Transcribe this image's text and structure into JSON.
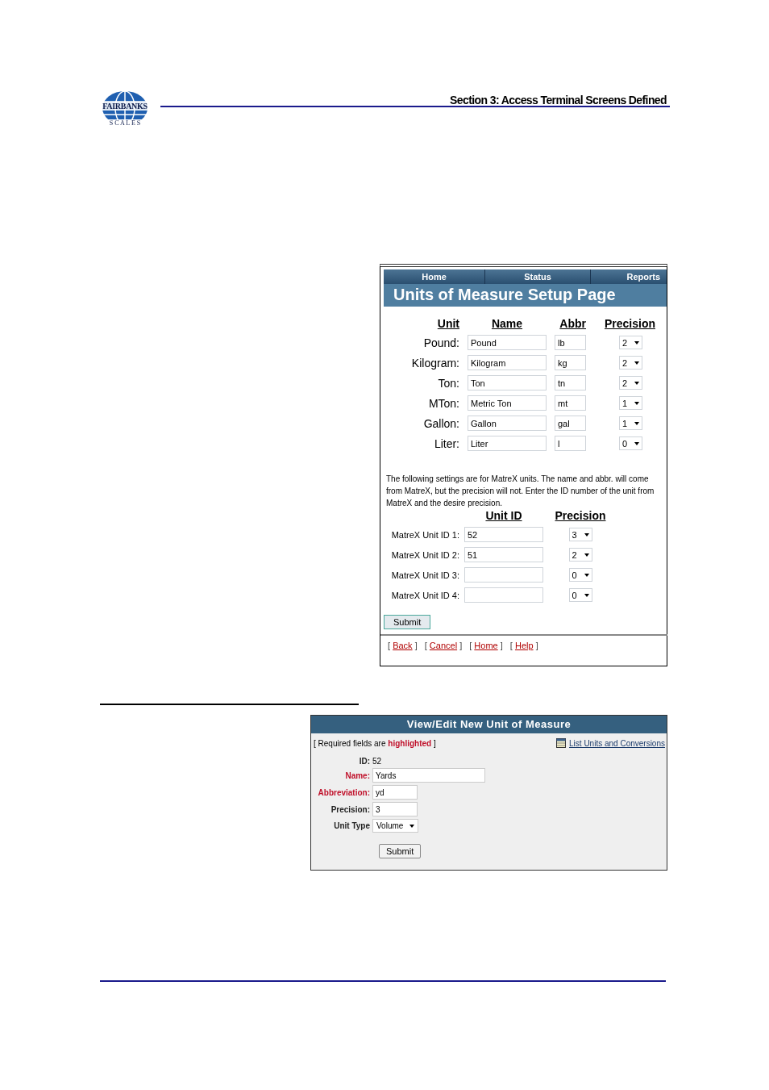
{
  "header": {
    "logo_text": "FAIRBANKS",
    "logo_subtext": "S C A L E S",
    "section_title": "Section 3:  Access Terminal Screens Defined"
  },
  "setup_page": {
    "nav": [
      {
        "label": "Home"
      },
      {
        "label": "Status"
      },
      {
        "label": "Reports"
      }
    ],
    "title": "Units of Measure Setup Page",
    "columns": [
      "Unit",
      "Name",
      "Abbr",
      "Precision"
    ],
    "units": [
      {
        "unit": "Pound:",
        "name": "Pound",
        "abbr": "lb",
        "precision": "2"
      },
      {
        "unit": "Kilogram:",
        "name": "Kilogram",
        "abbr": "kg",
        "precision": "2"
      },
      {
        "unit": "Ton:",
        "name": "Ton",
        "abbr": "tn",
        "precision": "2"
      },
      {
        "unit": "MTon:",
        "name": "Metric Ton",
        "abbr": "mt",
        "precision": "1"
      },
      {
        "unit": "Gallon:",
        "name": "Gallon",
        "abbr": "gal",
        "precision": "1"
      },
      {
        "unit": "Liter:",
        "name": "Liter",
        "abbr": "l",
        "precision": "0"
      }
    ],
    "note": "The following settings are for MatreX units. The name and abbr. will come from MatreX, but the precision will not. Enter the ID number of the unit from MatreX and the desire precision.",
    "matrex_columns": [
      "Unit ID",
      "Precision"
    ],
    "matrex_units": [
      {
        "label": "MatreX Unit ID 1:",
        "unit_id": "52",
        "precision": "3"
      },
      {
        "label": "MatreX Unit ID 2:",
        "unit_id": "51",
        "precision": "2"
      },
      {
        "label": "MatreX Unit ID 3:",
        "precision": "0"
      },
      {
        "label": "MatreX Unit ID 4:",
        "precision": "0"
      }
    ],
    "submit": "Submit",
    "links": [
      {
        "open": "[",
        "label": "Back",
        "close": "]"
      },
      {
        "open": "[",
        "label": "Cancel",
        "close": "]"
      },
      {
        "open": "[",
        "label": "Home",
        "close": "]"
      },
      {
        "open": "[",
        "label": "Help",
        "close": "]"
      }
    ]
  },
  "edit_page": {
    "title": "View/Edit New Unit of Measure",
    "required_note": "[ Required fields are **highlighted** ]",
    "list_link": "List Units and Conversions",
    "fields": [
      {
        "kind": "text",
        "label": "ID:",
        "value": "52",
        "required": false
      },
      {
        "kind": "input",
        "label": "Name:",
        "value": "Yards",
        "required": true,
        "wide": true
      },
      {
        "kind": "input",
        "label": "Abbreviation:",
        "value": "yd",
        "required": true,
        "wide": false
      },
      {
        "kind": "input",
        "label": "Precision:",
        "value": "3",
        "required": false,
        "wide": false
      },
      {
        "kind": "select",
        "label": "Unit Type",
        "value": "Volume",
        "required": false
      }
    ],
    "submit": "Submit"
  }
}
